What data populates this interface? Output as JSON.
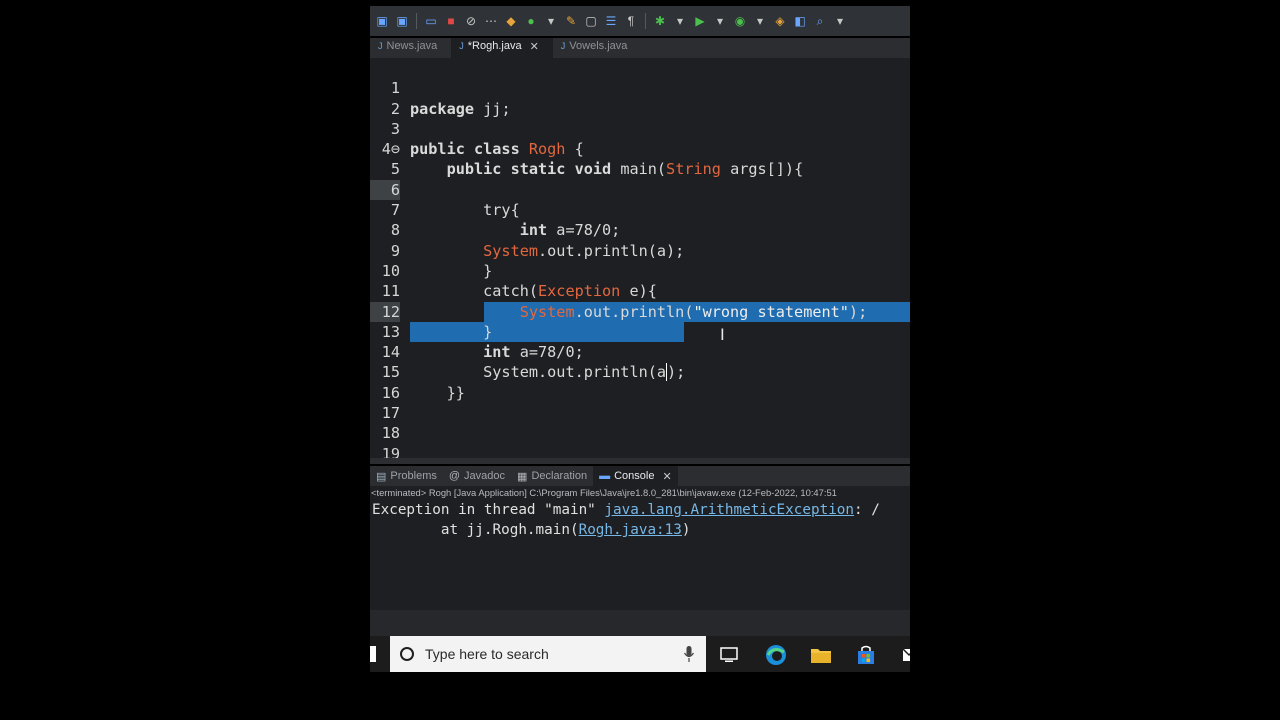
{
  "toolbar": {
    "icons": [
      "save-icon",
      "save-all-icon",
      "print-icon",
      "stop-icon",
      "skip-breakpoints-icon",
      "step-icon",
      "new-java-package-icon",
      "new-class-icon",
      "edit-icon",
      "open-type-icon",
      "task-list-icon",
      "show-whitespace-icon",
      "debug-icon",
      "run-icon",
      "run-external-icon",
      "open-perspective-icon",
      "java-perspective-icon",
      "search-icon"
    ]
  },
  "editor_tabs": [
    {
      "label": "News.java",
      "active": false
    },
    {
      "label": "*Rogh.java",
      "active": true
    },
    {
      "label": "Vowels.java",
      "active": false
    }
  ],
  "editor": {
    "lines": [
      {
        "n": "1"
      },
      {
        "n": "2"
      },
      {
        "n": "3"
      },
      {
        "n": "4⊖"
      },
      {
        "n": "5"
      },
      {
        "n": "6"
      },
      {
        "n": "7"
      },
      {
        "n": "8"
      },
      {
        "n": "9"
      },
      {
        "n": "10"
      },
      {
        "n": "11"
      },
      {
        "n": "12"
      },
      {
        "n": "13"
      },
      {
        "n": "14"
      },
      {
        "n": "15"
      },
      {
        "n": "16"
      },
      {
        "n": "17"
      },
      {
        "n": "18"
      },
      {
        "n": "19"
      }
    ],
    "code": {
      "l1a": "package",
      "l1b": " jj;",
      "l3a": "public class",
      "l3b": " Rogh",
      "l3c": " {",
      "l4a": "    public static void",
      "l4b": " main(",
      "l4c": "String",
      "l4d": " args[]){",
      "l6": "        try{",
      "l7a": "            int",
      "l7b": " a=78/0;",
      "l8a": "        System",
      "l8b": ".out.println(a);",
      "l9": "        }",
      "l10a": "        catch(",
      "l10b": "Exception",
      "l10c": " e){",
      "l11a": "            System",
      "l11b": ".out.println(",
      "l11c": "\"wrong statement\"",
      "l11d": ");",
      "l12": "        }",
      "l13a": "        int",
      "l13b": " a=78/0;",
      "l14a": "        System.out.println(a",
      "l14b": ");",
      "l15": "    }}"
    }
  },
  "panel": {
    "tabs": [
      {
        "label": "Problems",
        "icon": "problems-icon",
        "active": false
      },
      {
        "label": "Javadoc",
        "icon": "javadoc-icon",
        "active": false
      },
      {
        "label": "Declaration",
        "icon": "declaration-icon",
        "active": false
      },
      {
        "label": "Console",
        "icon": "console-icon",
        "active": true
      }
    ],
    "status": "<terminated> Rogh [Java Application] C:\\Program Files\\Java\\jre1.8.0_281\\bin\\javaw.exe (12-Feb-2022, 10:47:51",
    "console_line1_a": "Exception in thread \"main\" ",
    "console_line1_link": "java.lang.ArithmeticException",
    "console_line1_b": ": /",
    "console_line2_a": "        at jj.Rogh.main(",
    "console_line2_link": "Rogh.java:13",
    "console_line2_b": ")"
  },
  "taskbar": {
    "search_placeholder": "Type here to search",
    "icons": [
      "task-view-icon",
      "edge-icon",
      "file-explorer-icon",
      "store-icon",
      "mail-icon"
    ]
  },
  "colors": {
    "editor_bg": "#1e1f22",
    "selection": "#1f6cb0",
    "keyword_class": "#e3673f",
    "link": "#77b7e6"
  }
}
